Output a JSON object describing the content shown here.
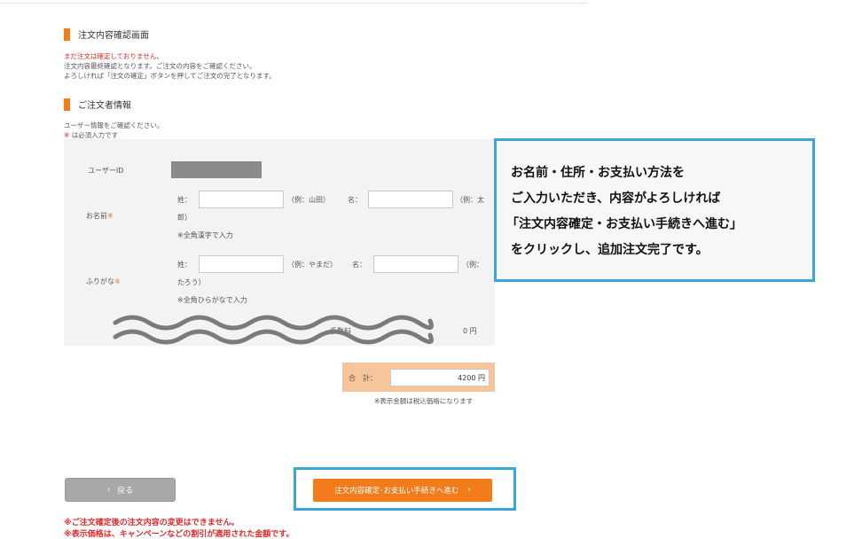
{
  "confirm_section": {
    "title": "注文内容確認画面",
    "warning": "まだ注文は確定しておりません。",
    "line1": "注文内容最終確認となります。ご注文の内容をご確認ください。",
    "line2": "よろしければ「注文の確定」ボタンを押してご注文の完了となります。"
  },
  "orderer_section": {
    "title": "ご注文者情報",
    "line1": "ユーザー情報をご確認ください。",
    "required_mark": "※",
    "required_text": "は必須入力です"
  },
  "form": {
    "user_id_label": "ユーザーID",
    "name_label": "お名前",
    "furigana_label": "ふりがな",
    "required_mark": "※",
    "sei_label": "姓：",
    "mei_label": "名：",
    "name_ex_sei": "（例：山田）",
    "name_ex_mei": "（例：太",
    "name_ex_mei_cont": "郎）",
    "name_note": "※全角漢字で入力",
    "furi_ex_sei": "（例：やまだ）",
    "furi_ex_mei": "（例：",
    "furi_ex_mei_cont": "たろう）",
    "furi_note": "※全角ひらがなで入力",
    "fee_label": "手数料",
    "fee_value": "0 円"
  },
  "total": {
    "label": "合　計：",
    "value": "4200 円",
    "tax_note": "※表示金額は税込価格になります"
  },
  "callout": {
    "line1": "お名前・住所・お支払い方法を",
    "line2": "ご入力いただき、内容がよろしければ",
    "line3": "「注文内容確定・お支払い手続きへ進む」",
    "line4": "をクリックし、追加注文完了です。"
  },
  "buttons": {
    "back_label": "戻る",
    "next_label": "注文内容確定･お支払い手続きへ進む"
  },
  "bottom": {
    "note1": "※ご注文確定後の注文内容の変更はできません。",
    "note2": "※表示価格は、キャンペーンなどの割引が適用された金額です。"
  },
  "colors": {
    "accent": "#f27c1b",
    "highlight": "#3aa6d9",
    "required": "#e02a2a"
  }
}
